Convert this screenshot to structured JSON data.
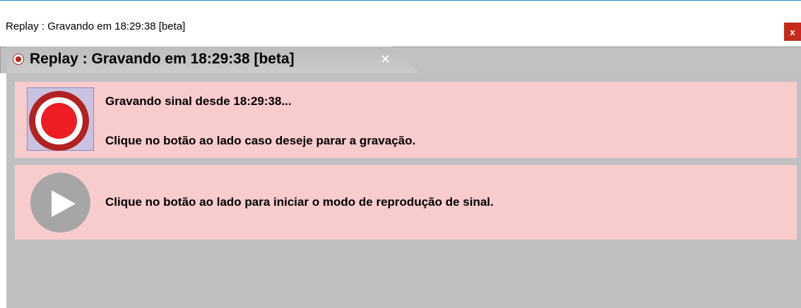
{
  "window": {
    "title": "Replay : Gravando em 18:29:38 [beta]",
    "close_label": "x"
  },
  "tab": {
    "title": "Replay : Gravando em 18:29:38 [beta]",
    "close_label": "✕",
    "icon": "record-icon"
  },
  "recording_panel": {
    "button_icon": "record-icon",
    "status_text": "Gravando sinal desde 18:29:38...",
    "instruction_text": "Clique no botão ao lado caso deseje parar a gravação."
  },
  "replay_panel": {
    "button_icon": "play-icon",
    "instruction_text": "Clique no botão ao lado para iniciar o modo de reprodução de sinal."
  },
  "colors": {
    "panel_background": "#f8cbcd",
    "content_background": "#c0c0c0",
    "record_red": "#ee1c24",
    "close_red": "#c42b1c"
  }
}
